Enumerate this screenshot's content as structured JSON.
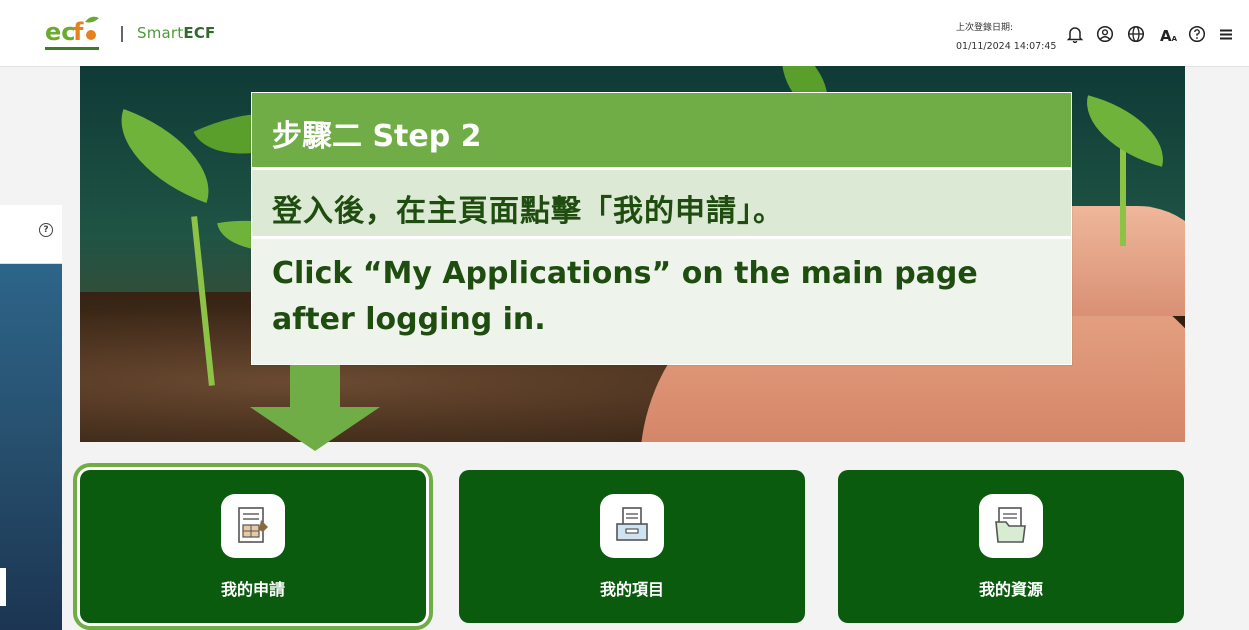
{
  "header": {
    "brand_prefix": "Smart",
    "brand_suffix": "ECF",
    "last_login_label": "上次登錄日期:",
    "last_login_time": "01/11/2024 14:07:45",
    "font_size_icon_text": "A",
    "font_size_icon_sub": "A"
  },
  "callout": {
    "step_title": "步驟二 Step 2",
    "instruction_zh": "登入後，在主頁面點擊「我的申請」。",
    "instruction_en": "Click “My Applications” on the main page after logging in."
  },
  "cards": [
    {
      "label": "我的申請",
      "icon": "application-form-icon",
      "highlighted": true
    },
    {
      "label": "我的項目",
      "icon": "project-tray-icon",
      "highlighted": false
    },
    {
      "label": "我的資源",
      "icon": "resource-folder-icon",
      "highlighted": false
    }
  ],
  "colors": {
    "card_green": "#0b5b0f",
    "accent_green": "#70ad47",
    "callout_zh_bg": "#dce9d5",
    "callout_en_bg": "#eef4ec"
  }
}
